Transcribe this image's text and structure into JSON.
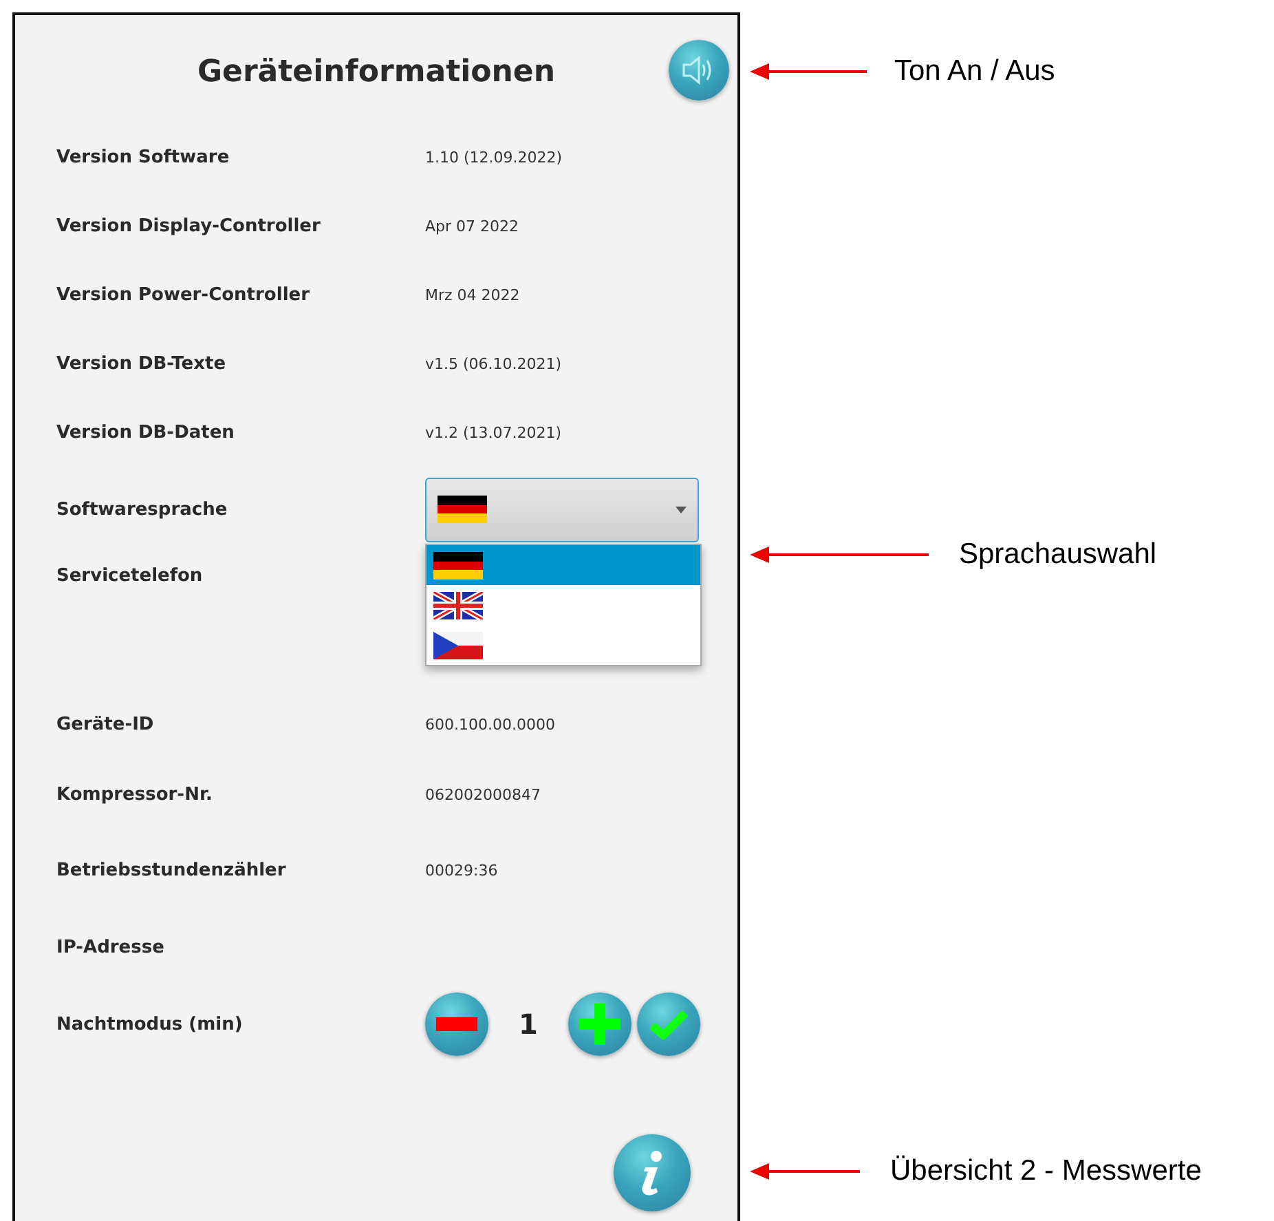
{
  "title": "Geräteinformationen",
  "rows": [
    {
      "kind": "text",
      "label": "Version Software",
      "value": "1.10 (12.09.2022)"
    },
    {
      "kind": "text",
      "label": "Version Display-Controller",
      "value": "Apr 07 2022"
    },
    {
      "kind": "text",
      "label": "Version Power-Controller",
      "value": "Mrz 04 2022"
    },
    {
      "kind": "text",
      "label": "Version DB-Texte",
      "value": "v1.5 (06.10.2021)"
    },
    {
      "kind": "text",
      "label": "Version DB-Daten",
      "value": "v1.2 (13.07.2021)"
    },
    {
      "kind": "select",
      "label": "Softwaresprache",
      "expanded": true,
      "options": [
        {
          "kind": "de",
          "selected": true
        },
        {
          "kind": "gb",
          "selected": false
        },
        {
          "kind": "cz",
          "selected": false
        }
      ]
    },
    {
      "kind": "text",
      "label": "Servicetelefon"
    },
    {
      "kind": "text",
      "label": "Geräte-ID",
      "value": "600.100.00.0000"
    },
    {
      "kind": "text",
      "label": "Kompressor-Nr.",
      "value": "062002000847"
    },
    {
      "kind": "text",
      "label": "Betriebsstundenzähler",
      "value": "00029:36"
    },
    {
      "kind": "text",
      "label": "IP-Adresse"
    },
    {
      "kind": "stepper",
      "label": "Nachtmodus (min)",
      "value": "1"
    }
  ],
  "annotations": [
    {
      "text": "Ton An / Aus"
    },
    {
      "text": "Sprachauswahl"
    },
    {
      "text": "Übersicht 2 - Messwerte"
    }
  ]
}
